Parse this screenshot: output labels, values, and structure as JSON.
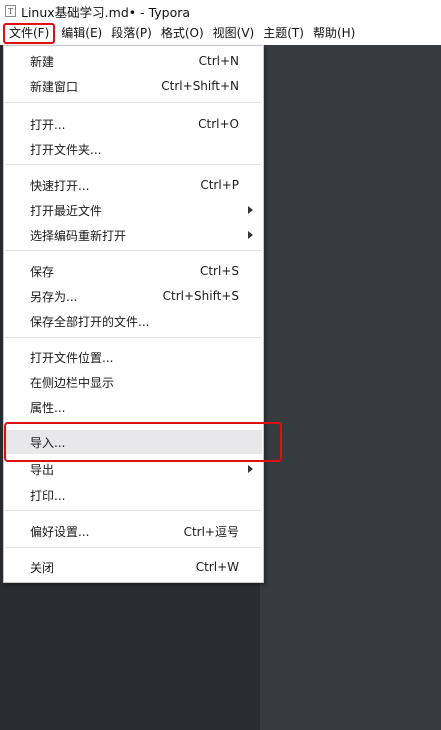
{
  "window": {
    "title": "Linux基础学习.md• - Typora",
    "app_icon_glyph": "T"
  },
  "menubar": {
    "items": [
      {
        "label": "文件(F)"
      },
      {
        "label": "编辑(E)"
      },
      {
        "label": "段落(P)"
      },
      {
        "label": "格式(O)"
      },
      {
        "label": "视图(V)"
      },
      {
        "label": "主题(T)"
      },
      {
        "label": "帮助(H)"
      }
    ]
  },
  "file_menu": {
    "groups": [
      [
        {
          "label": "新建",
          "shortcut": "Ctrl+N"
        },
        {
          "label": "新建窗口",
          "shortcut": "Ctrl+Shift+N"
        }
      ],
      [
        {
          "label": "打开...",
          "shortcut": "Ctrl+O"
        },
        {
          "label": "打开文件夹...",
          "shortcut": ""
        }
      ],
      [
        {
          "label": "快速打开...",
          "shortcut": "Ctrl+P"
        },
        {
          "label": "打开最近文件",
          "shortcut": "",
          "submenu": true
        },
        {
          "label": "选择编码重新打开",
          "shortcut": "",
          "submenu": true
        }
      ],
      [
        {
          "label": "保存",
          "shortcut": "Ctrl+S"
        },
        {
          "label": "另存为...",
          "shortcut": "Ctrl+Shift+S"
        },
        {
          "label": "保存全部打开的文件...",
          "shortcut": ""
        }
      ],
      [
        {
          "label": "打开文件位置...",
          "shortcut": ""
        },
        {
          "label": "在侧边栏中显示",
          "shortcut": ""
        },
        {
          "label": "属性...",
          "shortcut": ""
        }
      ],
      [
        {
          "label": "导入...",
          "shortcut": "",
          "highlighted": true
        },
        {
          "label": "导出",
          "shortcut": "",
          "submenu": true
        },
        {
          "label": "打印...",
          "shortcut": ""
        }
      ],
      [
        {
          "label": "偏好设置...",
          "shortcut": "Ctrl+逗号"
        }
      ],
      [
        {
          "label": "关闭",
          "shortcut": "Ctrl+W"
        }
      ]
    ]
  },
  "colors": {
    "annotation_red": "#E01010",
    "editor_background": "#363B40",
    "sidebar_background": "#2A2D30",
    "hover_background": "#E8E8EA"
  }
}
